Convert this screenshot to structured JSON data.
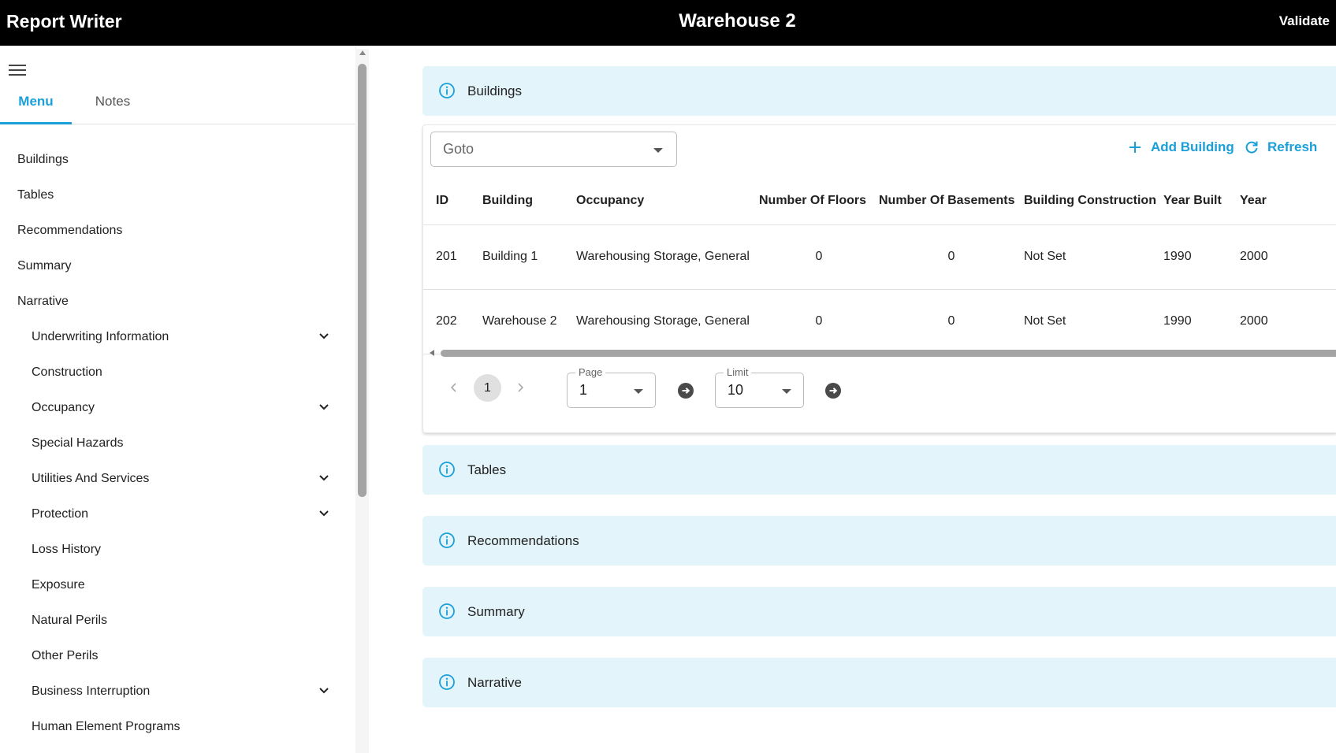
{
  "header": {
    "app_title": "Report Writer",
    "page_title": "Warehouse 2",
    "validate_label": "Validate"
  },
  "sidebar": {
    "tabs": [
      {
        "label": "Menu",
        "active": true
      },
      {
        "label": "Notes",
        "active": false
      }
    ],
    "items": [
      {
        "label": "Buildings",
        "level": 1,
        "expandable": false
      },
      {
        "label": "Tables",
        "level": 1,
        "expandable": false
      },
      {
        "label": "Recommendations",
        "level": 1,
        "expandable": false
      },
      {
        "label": "Summary",
        "level": 1,
        "expandable": false
      },
      {
        "label": "Narrative",
        "level": 1,
        "expandable": false
      },
      {
        "label": "Underwriting Information",
        "level": 2,
        "expandable": true
      },
      {
        "label": "Construction",
        "level": 2,
        "expandable": false
      },
      {
        "label": "Occupancy",
        "level": 2,
        "expandable": true
      },
      {
        "label": "Special Hazards",
        "level": 2,
        "expandable": false
      },
      {
        "label": "Utilities And Services",
        "level": 2,
        "expandable": true
      },
      {
        "label": "Protection",
        "level": 2,
        "expandable": true
      },
      {
        "label": "Loss History",
        "level": 2,
        "expandable": false
      },
      {
        "label": "Exposure",
        "level": 2,
        "expandable": false
      },
      {
        "label": "Natural Perils",
        "level": 2,
        "expandable": false
      },
      {
        "label": "Other Perils",
        "level": 2,
        "expandable": false
      },
      {
        "label": "Business Interruption",
        "level": 2,
        "expandable": true
      },
      {
        "label": "Human Element Programs",
        "level": 2,
        "expandable": false
      }
    ]
  },
  "sections": [
    {
      "key": "buildings",
      "label": "Buildings"
    },
    {
      "key": "tables",
      "label": "Tables"
    },
    {
      "key": "recommendations",
      "label": "Recommendations"
    },
    {
      "key": "summary",
      "label": "Summary"
    },
    {
      "key": "narrative",
      "label": "Narrative"
    }
  ],
  "buildings_table": {
    "goto_placeholder": "Goto",
    "add_label": "Add Building",
    "refresh_label": "Refresh",
    "columns": [
      "ID",
      "Building",
      "Occupancy",
      "Number Of Floors",
      "Number Of Basements",
      "Building Construction",
      "Year Built",
      "Year"
    ],
    "rows": [
      [
        "201",
        "Building 1",
        "Warehousing Storage, General",
        "0",
        "0",
        "Not Set",
        "1990",
        "2000"
      ],
      [
        "202",
        "Warehouse 2",
        "Warehousing Storage, General",
        "0",
        "0",
        "Not Set",
        "1990",
        "2000"
      ]
    ]
  },
  "pagination": {
    "current_page": "1",
    "page_label": "Page",
    "page_value": "1",
    "limit_label": "Limit",
    "limit_value": "10"
  },
  "colors": {
    "accent": "#1a9fd9",
    "header_bg": "#000000",
    "section_bg": "#e3f5fb"
  }
}
